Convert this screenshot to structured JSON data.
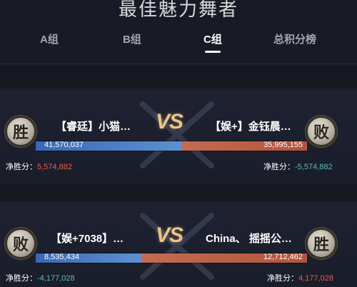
{
  "page": {
    "title": "最佳魅力舞者"
  },
  "tabs": [
    {
      "label": "A组",
      "active": false
    },
    {
      "label": "B组",
      "active": false
    },
    {
      "label": "C组",
      "active": true
    },
    {
      "label": "总积分榜",
      "active": false
    }
  ],
  "matches": [
    {
      "vs_label": "VS",
      "left": {
        "name": "【睿廷】小猫…",
        "result": "胜",
        "score": "41,570,037",
        "net_label": "净胜分：",
        "net_score": "5,574,882"
      },
      "right": {
        "name": "【娱+】金钰晨…",
        "result": "败",
        "score": "35,995,155",
        "net_label": "净胜分：",
        "net_score": "-5,574,882"
      },
      "left_share": 0.536
    },
    {
      "vs_label": "VS",
      "left": {
        "name": "【娱+7038】…",
        "result": "败",
        "score": "8,535,434",
        "net_label": "净胜分：",
        "net_score": "-4,177,028"
      },
      "right": {
        "name": "China、 摇摇公…",
        "result": "胜",
        "score": "12,712,462",
        "net_label": "净胜分：",
        "net_score": "4,177,028"
      },
      "left_share": 0.39
    }
  ],
  "colors": {
    "win": "#e0614a",
    "lose": "#5fbcc0",
    "left_bar": "#4a7fc4",
    "right_bar": "#bd5f47",
    "vs": "#e7c48a"
  }
}
